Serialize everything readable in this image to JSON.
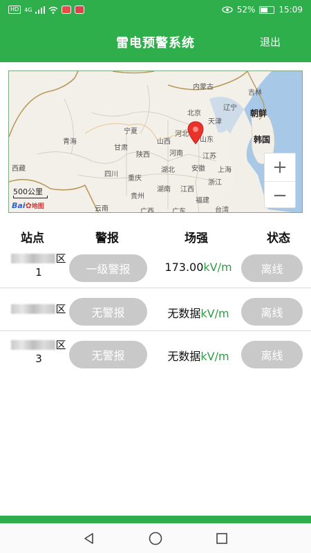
{
  "status_bar": {
    "left_chip": "HD",
    "network": "4G",
    "battery_text": "52%",
    "battery_level": 0.52,
    "time": "15:09"
  },
  "header": {
    "title": "雷电预警系统",
    "logout_label": "退出"
  },
  "map": {
    "labels": [
      {
        "text": "内蒙古"
      },
      {
        "text": "吉林"
      },
      {
        "text": "北京"
      },
      {
        "text": "天津"
      },
      {
        "text": "辽宁"
      },
      {
        "text": "朝鲜"
      },
      {
        "text": "宁夏"
      },
      {
        "text": "河北"
      },
      {
        "text": "山东"
      },
      {
        "text": "韩国"
      },
      {
        "text": "青海"
      },
      {
        "text": "甘肃"
      },
      {
        "text": "山西"
      },
      {
        "text": "陕西"
      },
      {
        "text": "河南"
      },
      {
        "text": "江苏"
      },
      {
        "text": "西藏"
      },
      {
        "text": "四川"
      },
      {
        "text": "湖北"
      },
      {
        "text": "安徽"
      },
      {
        "text": "上海"
      },
      {
        "text": "重庆"
      },
      {
        "text": "浙江"
      },
      {
        "text": "贵州"
      },
      {
        "text": "湖南"
      },
      {
        "text": "江西"
      },
      {
        "text": "福建"
      },
      {
        "text": "云南"
      },
      {
        "text": "广西"
      },
      {
        "text": "广东"
      },
      {
        "text": "台湾"
      }
    ],
    "zoom_in": "+",
    "zoom_out": "−",
    "scale": "500公里",
    "logo_text": "Bai",
    "logo_suffix": "地图"
  },
  "table": {
    "headers": {
      "station": "站点",
      "alarm": "警报",
      "field": "场强",
      "status": "状态"
    },
    "rows": [
      {
        "name_suffix": "区",
        "index": "1",
        "alarm": "一级警报",
        "field_value": "173.00",
        "unit": "kV/m",
        "status": "离线"
      },
      {
        "name_suffix": "区",
        "index": "",
        "alarm": "无警报",
        "field_value": "无数据",
        "unit": "kV/m",
        "status": "离线"
      },
      {
        "name_suffix": "区",
        "index": "3",
        "alarm": "无警报",
        "field_value": "无数据",
        "unit": "kV/m",
        "status": "离线"
      }
    ]
  },
  "colors": {
    "primary": "#2fae4c",
    "pill": "#c9c9c9",
    "unit": "#2f9c45"
  }
}
